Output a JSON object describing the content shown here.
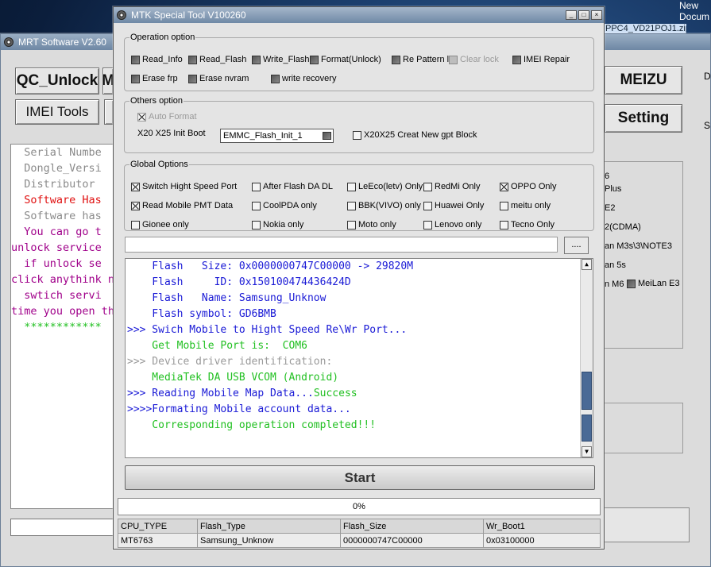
{
  "desktop": {
    "corner_text": [
      "New",
      "Docum"
    ],
    "file_label": "PPC4_VD21POJ1.zip"
  },
  "mrt": {
    "title": "MRT Software V2.60",
    "buttons": {
      "qc_unlock": "QC_Unlock",
      "m_partial": "M",
      "imei_tools": "IMEI Tools",
      "meizu": "MEIZU",
      "setting": "Setting"
    },
    "log_lines": [
      {
        "text": "  Serial Numbe",
        "color": "#8a8a8a"
      },
      {
        "text": "  Dongle_Versi",
        "color": "#8a8a8a"
      },
      {
        "text": "  Distributor",
        "color": "#8a8a8a"
      },
      {
        "text": "  Software Has",
        "color": "#e01010"
      },
      {
        "text": "  Software has",
        "color": "#8a8a8a"
      },
      {
        "text": "  You can go t",
        "color": "#a0008a"
      },
      {
        "text": "unlock service",
        "color": "#a0008a"
      },
      {
        "text": "  if unlock se",
        "color": "#a0008a"
      },
      {
        "text": "click anythink n",
        "color": "#a0008a"
      },
      {
        "text": "  swtich servi",
        "color": "#a0008a"
      },
      {
        "text": "time you open th",
        "color": "#a0008a"
      },
      {
        "text": "  ************",
        "color": "#22c022"
      }
    ],
    "right_panel": [
      "6",
      "Plus",
      "E2",
      "2(CDMA)",
      "an M3s\\3\\NOTE3",
      "an 5s",
      "n M6",
      "MeiLan E3"
    ],
    "right_edge": [
      "D",
      "S"
    ]
  },
  "mtk": {
    "title": "MTK Special Tool V100260",
    "operation_option": {
      "title": "Operation option",
      "items": [
        {
          "label": "Read_Info",
          "state": "dark"
        },
        {
          "label": "Read_Flash",
          "state": "dark"
        },
        {
          "label": "Write_Flash",
          "state": "dark"
        },
        {
          "label": "Format(Unlock)",
          "state": "dark"
        },
        {
          "label": "Re Pattern l",
          "state": "dark"
        },
        {
          "label": "Clear lock",
          "state": "disabled"
        },
        {
          "label": "IMEI Repair",
          "state": "dark"
        },
        {
          "label": "Erase frp",
          "state": "dark"
        },
        {
          "label": "Erase nvram",
          "state": "dark"
        },
        {
          "label": "write recovery",
          "state": "dark"
        }
      ]
    },
    "others_option": {
      "title": "Others option",
      "auto_format": "Auto Format",
      "init_boot_label": "X20 X25 Init Boot",
      "init_boot_value": "EMMC_Flash_Init_1",
      "gpt_block": "X20X25 Creat New gpt Block"
    },
    "global_options": {
      "title": "Global Options",
      "items": [
        {
          "label": "Switch Hight Speed Port",
          "checked": true
        },
        {
          "label": "After Flash DA DL",
          "checked": false
        },
        {
          "label": "LeEco(letv) Only",
          "checked": false
        },
        {
          "label": "RedMi Only",
          "checked": false
        },
        {
          "label": "OPPO Only",
          "checked": true
        },
        {
          "label": "Read Mobile PMT Data",
          "checked": true
        },
        {
          "label": "CoolPDA only",
          "checked": false
        },
        {
          "label": "BBK(VIVO) only",
          "checked": false
        },
        {
          "label": "Huawei Only",
          "checked": false
        },
        {
          "label": "meitu only",
          "checked": false
        },
        {
          "label": "Gionee only",
          "checked": false
        },
        {
          "label": "Nokia only",
          "checked": false
        },
        {
          "label": "Moto only",
          "checked": false
        },
        {
          "label": "Lenovo only",
          "checked": false
        },
        {
          "label": "Tecno Only",
          "checked": false
        }
      ]
    },
    "browse_label": "....",
    "log": [
      {
        "parts": [
          {
            "text": "    Flash   Size: 0x0000000747C00000 -> 29820M",
            "color": "blue"
          }
        ]
      },
      {
        "parts": [
          {
            "text": "    Flash     ID: 0x150100474436424D",
            "color": "blue"
          }
        ]
      },
      {
        "parts": [
          {
            "text": "    Flash   Name: Samsung_Unknow",
            "color": "blue"
          }
        ]
      },
      {
        "parts": [
          {
            "text": "    Flash symbol: GD6BMB",
            "color": "blue"
          }
        ]
      },
      {
        "parts": [
          {
            "text": ">>> Swich Mobile to Hight Speed Re\\Wr Port...",
            "color": "blue"
          }
        ]
      },
      {
        "parts": [
          {
            "text": "    Get Mobile Port is:  COM6",
            "color": "green"
          }
        ]
      },
      {
        "parts": [
          {
            "text": ">>> Device driver identification:",
            "color": "grey"
          }
        ]
      },
      {
        "parts": [
          {
            "text": "    MediaTek DA USB VCOM (Android)",
            "color": "green"
          }
        ]
      },
      {
        "parts": [
          {
            "text": ">>> Reading Mobile Map Data...",
            "color": "blue"
          },
          {
            "text": "Success",
            "color": "green"
          }
        ]
      },
      {
        "parts": [
          {
            "text": ">>>>Formating Mobile account data...",
            "color": "blue"
          }
        ]
      },
      {
        "parts": [
          {
            "text": "    Corresponding operation completed!!!",
            "color": "green"
          }
        ]
      }
    ],
    "start_label": "Start",
    "progress": {
      "value": 0,
      "label": "0%"
    },
    "table": {
      "headers": [
        "CPU_TYPE",
        "Flash_Type",
        "Flash_Size",
        "Wr_Boot1"
      ],
      "row": [
        "MT6763",
        "Samsung_Unknow",
        "0000000747C00000",
        "0x03100000"
      ]
    }
  }
}
